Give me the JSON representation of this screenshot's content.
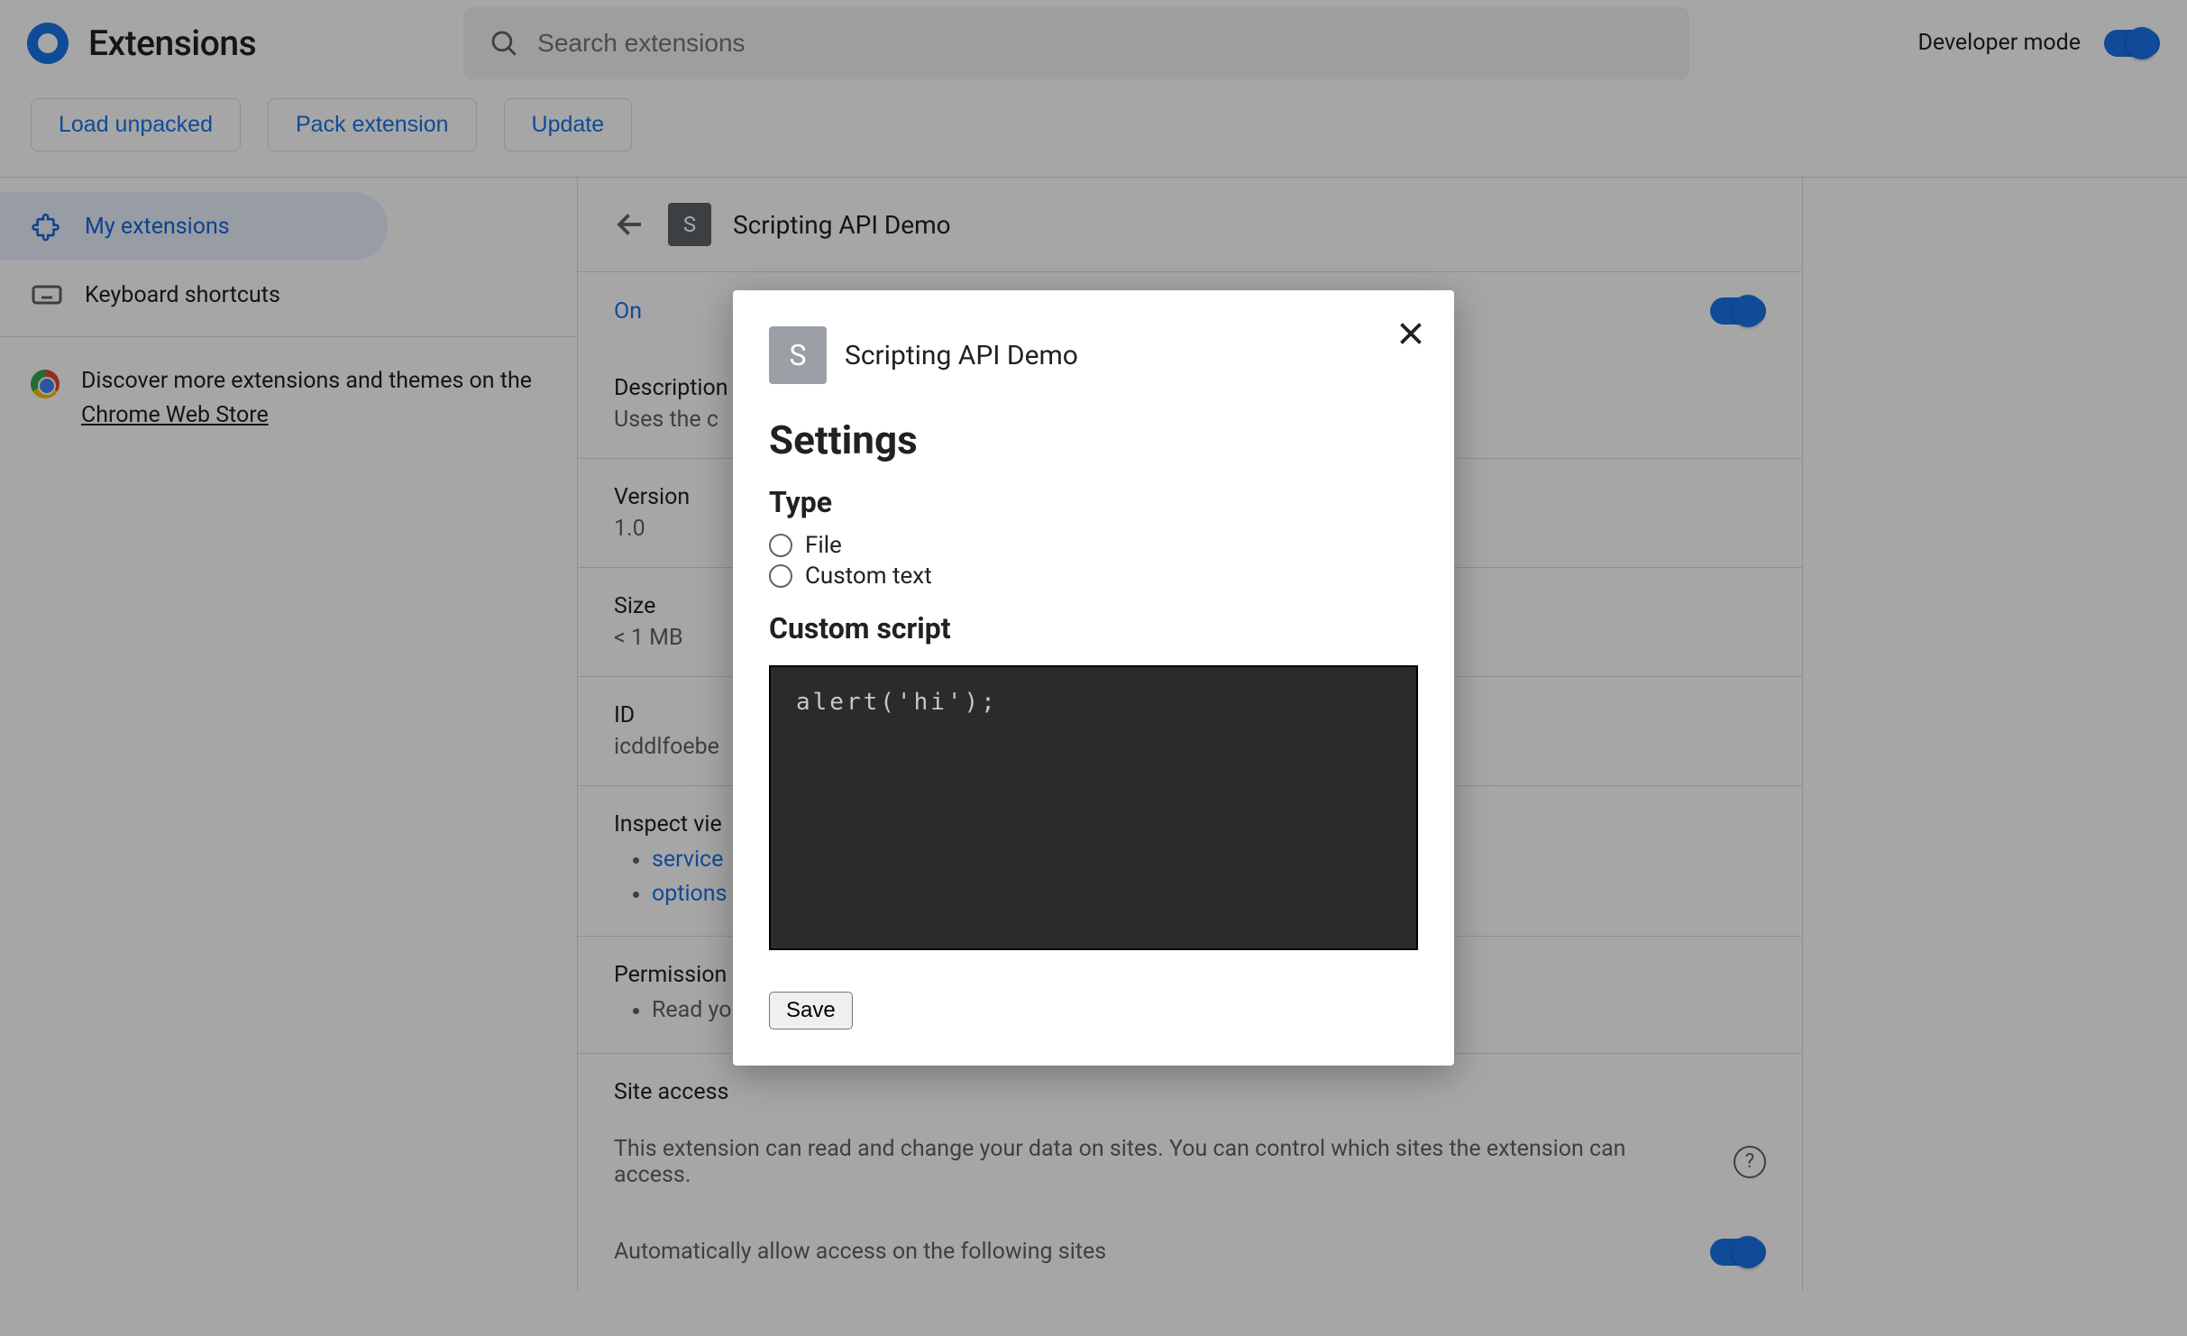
{
  "header": {
    "title": "Extensions",
    "search_placeholder": "Search extensions",
    "dev_mode_label": "Developer mode"
  },
  "actions": {
    "load_unpacked": "Load unpacked",
    "pack_extension": "Pack extension",
    "update": "Update"
  },
  "sidebar": {
    "my_extensions": "My extensions",
    "keyboard_shortcuts": "Keyboard shortcuts",
    "discover_prefix": "Discover more extensions and themes on the ",
    "discover_link": "Chrome Web Store"
  },
  "detail": {
    "back_icon_letter": "S",
    "name": "Scripting API Demo",
    "on_label": "On",
    "description_label": "Description",
    "description_value": "Uses the c",
    "version_label": "Version",
    "version_value": "1.0",
    "size_label": "Size",
    "size_value": "< 1 MB",
    "id_label": "ID",
    "id_value": "icddlfoebe",
    "inspect_label": "Inspect vie",
    "inspect_items": [
      "service",
      "options"
    ],
    "permissions_label": "Permission",
    "permissions_items": [
      "Read yo"
    ],
    "site_access_label": "Site access",
    "site_access_desc": "This extension can read and change your data on sites. You can control which sites the extension can access.",
    "auto_allow_label": "Automatically allow access on the following sites"
  },
  "modal": {
    "icon_letter": "S",
    "ext_name": "Scripting API Demo",
    "heading": "Settings",
    "type_heading": "Type",
    "type_options": [
      "File",
      "Custom text"
    ],
    "custom_heading": "Custom script",
    "script_value": "alert('hi');",
    "save_label": "Save"
  }
}
